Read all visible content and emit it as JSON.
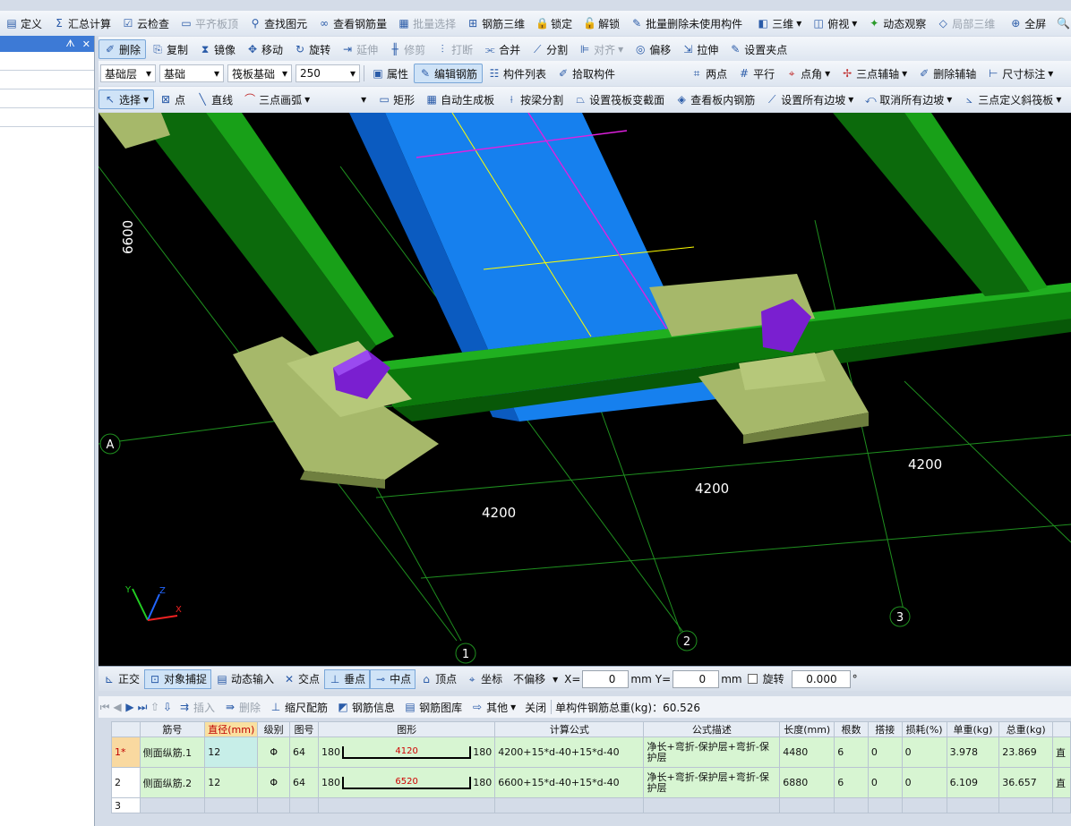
{
  "toolbar1": [
    "定义",
    "汇总计算",
    "云检查",
    "平齐板顶",
    "查找图元",
    "查看钢筋量",
    "批量选择",
    "钢筋三维",
    "锁定",
    "解锁",
    "批量删除未使用构件",
    "三维",
    "俯视",
    "动态观察",
    "局部三维",
    "全屏",
    "缩"
  ],
  "toolbar2": [
    "删除",
    "复制",
    "镜像",
    "移动",
    "旋转",
    "延伸",
    "修剪",
    "打断",
    "合并",
    "分割",
    "对齐",
    "偏移",
    "拉伸",
    "设置夹点"
  ],
  "toolbar3": {
    "layer": "基础层",
    "category": "基础",
    "type": "筏板基础",
    "size": "250",
    "items": [
      "属性",
      "编辑钢筋",
      "构件列表",
      "拾取构件",
      "两点",
      "平行",
      "点角",
      "三点辅轴",
      "删除辅轴",
      "尺寸标注"
    ]
  },
  "toolbar4": [
    "选择",
    "点",
    "直线",
    "三点画弧",
    "矩形",
    "自动生成板",
    "按梁分割",
    "设置筏板变截面",
    "查看板内钢筋",
    "设置所有边坡",
    "取消所有边坡",
    "三点定义斜筏板"
  ],
  "left_panel": {
    "pin": "ᗑ",
    "close": "✕"
  },
  "viewport": {
    "dims": [
      "6600",
      "4200",
      "4200",
      "4200"
    ],
    "axis_labels": [
      "A",
      "1",
      "2",
      "3"
    ],
    "axes": [
      "Y",
      "Z",
      "X"
    ]
  },
  "status": {
    "items": [
      "正交",
      "对象捕捉",
      "动态输入",
      "交点",
      "垂点",
      "中点",
      "顶点",
      "坐标"
    ],
    "offset_mode": "不偏移",
    "x_label": "X=",
    "x_value": "0",
    "y_label": "Y=",
    "y_value": "0",
    "unit": "mm",
    "rotate_label": "旋转",
    "rotate_value": "0.000",
    "degree": "°"
  },
  "grid_toolbar": {
    "items": [
      "插入",
      "删除",
      "缩尺配筋",
      "钢筋信息",
      "钢筋图库",
      "其他",
      "关闭"
    ],
    "total_label": "单构件钢筋总重(kg)：60.526"
  },
  "table": {
    "headers": [
      "筋号",
      "直径(mm)",
      "级别",
      "图号",
      "图形",
      "计算公式",
      "公式描述",
      "长度(mm)",
      "根数",
      "搭接",
      "损耗(%)",
      "单重(kg)",
      "总重(kg)",
      ""
    ],
    "rows": [
      {
        "no": "1*",
        "name": "侧面纵筋.1",
        "dia": "12",
        "grade": "Φ",
        "fig": "64",
        "left": "180",
        "mid": "4120",
        "right": "180",
        "formula": "4200+15*d-40+15*d-40",
        "desc": "净长+弯折-保护层+弯折-保护层",
        "len": "4480",
        "count": "6",
        "lap": "0",
        "loss": "0",
        "unit": "3.978",
        "total": "23.869",
        "extra": "直"
      },
      {
        "no": "2",
        "name": "侧面纵筋.2",
        "dia": "12",
        "grade": "Φ",
        "fig": "64",
        "left": "180",
        "mid": "6520",
        "right": "180",
        "formula": "6600+15*d-40+15*d-40",
        "desc": "净长+弯折-保护层+弯折-保护层",
        "len": "6880",
        "count": "6",
        "lap": "0",
        "loss": "0",
        "unit": "6.109",
        "total": "36.657",
        "extra": "直"
      },
      {
        "no": "3"
      }
    ]
  }
}
